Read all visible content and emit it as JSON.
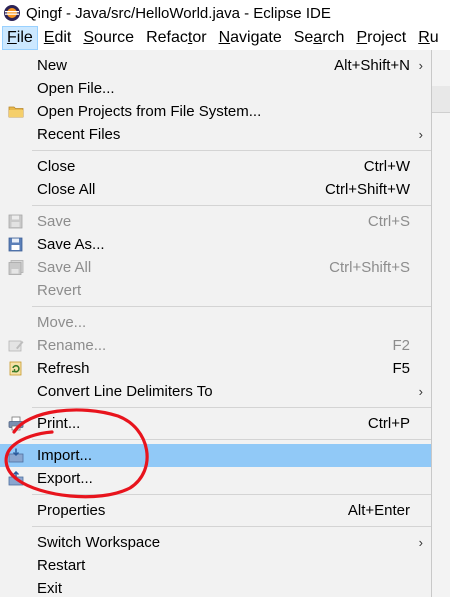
{
  "window": {
    "title": "Qingf - Java/src/HelloWorld.java - Eclipse IDE",
    "icon": "eclipse-icon"
  },
  "menubar": {
    "items": [
      {
        "label": "File",
        "mnemonic": "F",
        "rest": "ile",
        "active": true
      },
      {
        "label": "Edit",
        "mnemonic": "E",
        "rest": "dit"
      },
      {
        "label": "Source",
        "mnemonic": "S",
        "rest": "ource"
      },
      {
        "label": "Refactor",
        "pre": "Refac",
        "mnemonic": "t",
        "rest": "or"
      },
      {
        "label": "Navigate",
        "mnemonic": "N",
        "rest": "avigate"
      },
      {
        "label": "Search",
        "pre": "Se",
        "mnemonic": "a",
        "rest": "rch"
      },
      {
        "label": "Project",
        "mnemonic": "P",
        "rest": "roject"
      },
      {
        "label": "Ru",
        "mnemonic": "R",
        "rest": "u"
      }
    ]
  },
  "file_menu": {
    "new": {
      "label": "New",
      "shortcut": "Alt+Shift+N"
    },
    "open_file": {
      "label": "Open File..."
    },
    "open_projects": {
      "label": "Open Projects from File System...",
      "icon": "folder-icon"
    },
    "recent_files": {
      "label": "Recent Files"
    },
    "close": {
      "label": "Close",
      "shortcut": "Ctrl+W"
    },
    "close_all": {
      "label": "Close All",
      "shortcut": "Ctrl+Shift+W"
    },
    "save": {
      "label": "Save",
      "shortcut": "Ctrl+S",
      "icon": "save-icon"
    },
    "save_as": {
      "label": "Save As...",
      "icon": "save-as-icon"
    },
    "save_all": {
      "label": "Save All",
      "shortcut": "Ctrl+Shift+S",
      "icon": "save-all-icon"
    },
    "revert": {
      "label": "Revert"
    },
    "move": {
      "label": "Move..."
    },
    "rename": {
      "label": "Rename...",
      "shortcut": "F2",
      "icon": "rename-icon"
    },
    "refresh": {
      "label": "Refresh",
      "shortcut": "F5",
      "icon": "refresh-icon"
    },
    "convert": {
      "label": "Convert Line Delimiters To"
    },
    "print": {
      "label": "Print...",
      "shortcut": "Ctrl+P",
      "icon": "print-icon"
    },
    "import": {
      "label": "Import...",
      "icon": "import-icon"
    },
    "export": {
      "label": "Export...",
      "icon": "export-icon"
    },
    "properties": {
      "label": "Properties",
      "shortcut": "Alt+Enter"
    },
    "switch_workspace": {
      "label": "Switch Workspace"
    },
    "restart": {
      "label": "Restart"
    },
    "exit": {
      "label": "Exit"
    }
  },
  "submenu_arrow": "›",
  "colors": {
    "highlight": "#91c9f7",
    "menu_bg": "#f2f2f2",
    "annotation": "#e8141d"
  }
}
